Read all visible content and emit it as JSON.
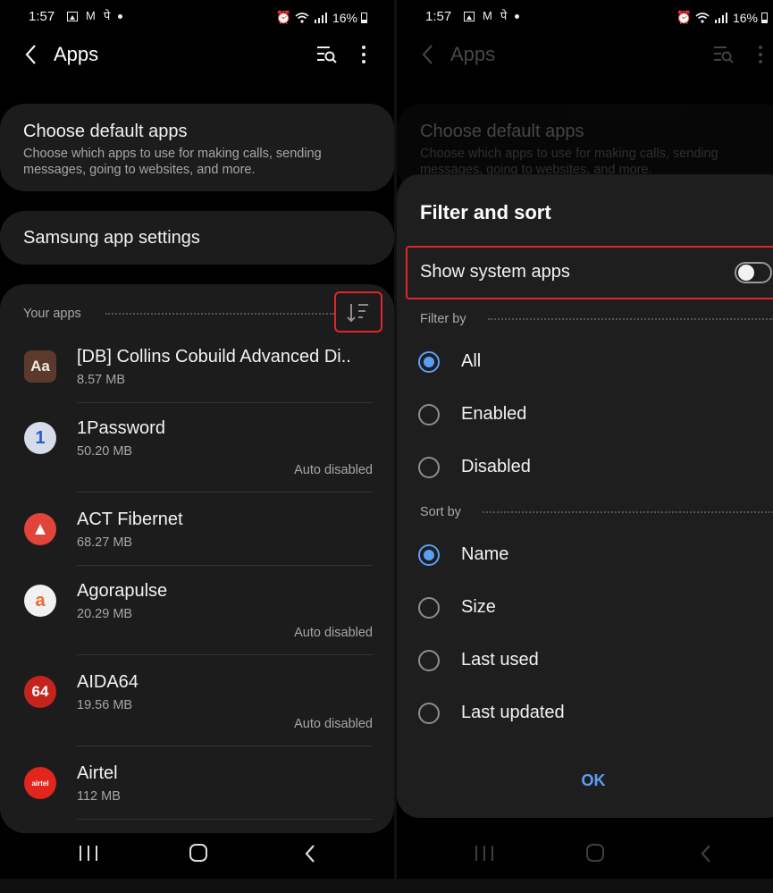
{
  "status": {
    "time": "1:57",
    "battery": "16%",
    "notif_glyphs": [
      "M",
      "पे"
    ]
  },
  "header": {
    "back_label": "Back",
    "title": "Apps"
  },
  "left": {
    "default_apps": {
      "title": "Choose default apps",
      "subtitle": "Choose which apps to use for making calls, sending messages, going to websites, and more."
    },
    "samsung_settings": {
      "title": "Samsung app settings"
    },
    "your_apps_label": "Your apps",
    "apps": [
      {
        "name": "[DB] Collins Cobuild Advanced Di..",
        "size": "8.57 MB",
        "status": "",
        "icon_text": "Aa",
        "icon_bg": "#5b3a2c",
        "icon_fg": "#f2e8e0"
      },
      {
        "name": "1Password",
        "size": "50.20 MB",
        "status": "Auto disabled",
        "icon_text": "1",
        "icon_bg": "#d6dde8",
        "icon_fg": "#2b5bd7"
      },
      {
        "name": "ACT Fibernet",
        "size": "68.27 MB",
        "status": "",
        "icon_text": "▲",
        "icon_bg": "#e0443a",
        "icon_fg": "#ffffff"
      },
      {
        "name": "Agorapulse",
        "size": "20.29 MB",
        "status": "Auto disabled",
        "icon_text": "a",
        "icon_bg": "#f1f1f1",
        "icon_fg": "#f0642e"
      },
      {
        "name": "AIDA64",
        "size": "19.56 MB",
        "status": "Auto disabled",
        "icon_text": "64",
        "icon_bg": "#c4241c",
        "icon_fg": "#ffffff"
      },
      {
        "name": "Airtel",
        "size": "112 MB",
        "status": "",
        "icon_text": "airtel",
        "icon_bg": "#e2261d",
        "icon_fg": "#ffffff"
      }
    ]
  },
  "sheet": {
    "title": "Filter and sort",
    "show_system_apps": "Show system apps",
    "show_system_apps_on": false,
    "filter_by_label": "Filter by",
    "filter_options": [
      {
        "label": "All",
        "selected": true
      },
      {
        "label": "Enabled",
        "selected": false
      },
      {
        "label": "Disabled",
        "selected": false
      }
    ],
    "sort_by_label": "Sort by",
    "sort_options": [
      {
        "label": "Name",
        "selected": true
      },
      {
        "label": "Size",
        "selected": false
      },
      {
        "label": "Last used",
        "selected": false
      },
      {
        "label": "Last updated",
        "selected": false
      }
    ],
    "ok_label": "OK"
  },
  "colors": {
    "accent": "#5a9ff5",
    "highlight": "#e0262b",
    "card": "#1c1c1c"
  }
}
